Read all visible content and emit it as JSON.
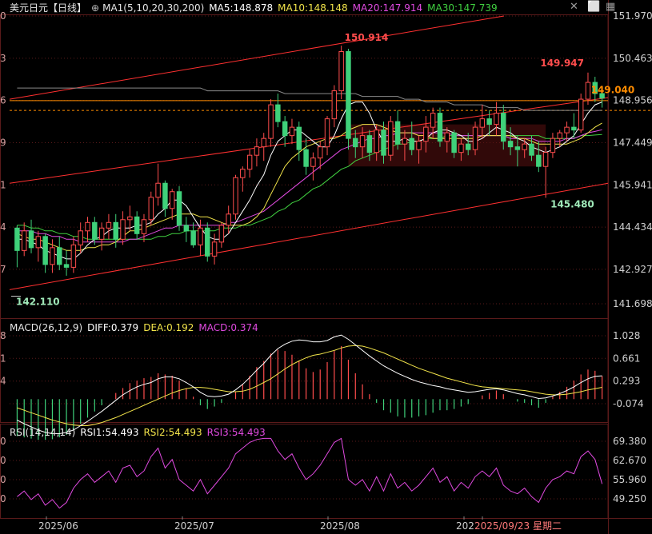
{
  "header": {
    "symbol": "美元日元",
    "period": "【日线】",
    "ma_title": "MA1(5,10,20,30,200)",
    "ma5": "MA5:148.878",
    "ma10": "MA10:148.148",
    "ma20": "MA20:147.914",
    "ma30": "MA30:147.739"
  },
  "macd_header": {
    "title": "MACD(26,12,9)",
    "diff": "DIFF:0.379",
    "dea": "DEA:0.192",
    "macd": "MACD:0.374"
  },
  "rsi_header": {
    "title": "RSI(14,14,14)",
    "rsi1": "RSI1:54.493",
    "rsi2": "RSI2:54.493",
    "rsi3": "RSI3:54.493"
  },
  "toolbar": {
    "close": "✕",
    "maximize": "⬜",
    "settings": "▦"
  },
  "colors": {
    "up": "#ff4d4d",
    "down": "#3fd17a",
    "ma5": "#ffffff",
    "ma10": "#f2e44a",
    "ma20": "#e04ae0",
    "ma30": "#40d040",
    "ma200": "#8a8a8a",
    "trend": "#ff3030",
    "hline": "#ff8c00",
    "grid": "#5a1a1a"
  },
  "chart_data": {
    "type": "candlestick",
    "x_labels": [
      "2025/06",
      "2025/07",
      "2025/08",
      "202",
      "2025/09/23 星期二"
    ],
    "price_axis": [
      "151.970",
      "150.463",
      "148.956",
      "147.449",
      "145.941",
      "144.434",
      "142.927",
      "141.698"
    ],
    "price_axis_left": [
      "0",
      "3",
      "6",
      "9",
      "1",
      "4",
      "7"
    ],
    "annotations": {
      "high": "150.914",
      "low": "142.110",
      "recent_high": "149.947",
      "recent_low": "145.480",
      "last_price": "149.040"
    },
    "ohlc": [
      [
        144.4,
        144.5,
        143.0,
        143.6
      ],
      [
        143.6,
        144.6,
        143.4,
        144.3
      ],
      [
        144.3,
        144.7,
        143.5,
        143.7
      ],
      [
        143.7,
        144.3,
        143.2,
        144.1
      ],
      [
        144.1,
        144.2,
        142.8,
        143.1
      ],
      [
        143.1,
        144.0,
        142.8,
        143.7
      ],
      [
        143.7,
        144.1,
        142.9,
        143.1
      ],
      [
        143.1,
        143.6,
        142.7,
        143.0
      ],
      [
        143.0,
        144.1,
        142.8,
        143.8
      ],
      [
        143.8,
        144.6,
        143.5,
        144.3
      ],
      [
        144.3,
        144.8,
        143.9,
        144.6
      ],
      [
        144.6,
        144.8,
        143.8,
        144.0
      ],
      [
        144.0,
        144.6,
        143.6,
        144.4
      ],
      [
        144.4,
        144.9,
        144.0,
        144.6
      ],
      [
        144.6,
        144.9,
        143.7,
        144.0
      ],
      [
        144.0,
        145.0,
        143.8,
        144.7
      ],
      [
        144.7,
        145.2,
        144.3,
        144.8
      ],
      [
        144.8,
        145.0,
        144.0,
        144.2
      ],
      [
        144.2,
        144.9,
        143.9,
        144.7
      ],
      [
        144.7,
        145.7,
        144.5,
        145.5
      ],
      [
        145.5,
        146.7,
        145.2,
        146.0
      ],
      [
        146.0,
        146.1,
        144.8,
        145.1
      ],
      [
        145.1,
        145.8,
        144.7,
        145.7
      ],
      [
        145.7,
        145.9,
        144.3,
        144.5
      ],
      [
        144.5,
        144.8,
        143.9,
        144.3
      ],
      [
        144.3,
        144.6,
        143.7,
        143.8
      ],
      [
        143.8,
        144.7,
        143.4,
        144.4
      ],
      [
        144.4,
        144.6,
        143.2,
        143.4
      ],
      [
        143.4,
        144.2,
        143.1,
        143.9
      ],
      [
        143.9,
        144.6,
        143.7,
        144.5
      ],
      [
        144.5,
        145.2,
        144.2,
        144.9
      ],
      [
        144.9,
        146.3,
        144.7,
        146.2
      ],
      [
        146.2,
        146.6,
        145.7,
        146.5
      ],
      [
        146.5,
        147.2,
        146.2,
        147.0
      ],
      [
        147.0,
        147.6,
        146.6,
        147.3
      ],
      [
        147.3,
        147.8,
        146.8,
        147.6
      ],
      [
        147.6,
        149.0,
        147.3,
        148.8
      ],
      [
        148.8,
        149.2,
        148.0,
        148.2
      ],
      [
        148.2,
        148.4,
        147.3,
        147.7
      ],
      [
        147.7,
        148.3,
        147.4,
        148.0
      ],
      [
        148.0,
        148.2,
        146.8,
        147.2
      ],
      [
        147.2,
        147.6,
        146.3,
        146.6
      ],
      [
        146.6,
        147.1,
        146.1,
        146.9
      ],
      [
        146.9,
        147.5,
        146.5,
        147.3
      ],
      [
        147.3,
        148.4,
        147.0,
        148.3
      ],
      [
        148.3,
        149.5,
        148.0,
        149.3
      ],
      [
        149.3,
        150.91,
        149.0,
        150.7
      ],
      [
        150.7,
        150.8,
        147.2,
        147.6
      ],
      [
        147.6,
        147.9,
        146.9,
        147.3
      ],
      [
        147.3,
        148.0,
        146.9,
        147.7
      ],
      [
        147.7,
        147.9,
        146.8,
        147.1
      ],
      [
        147.1,
        148.1,
        146.8,
        147.9
      ],
      [
        147.9,
        148.2,
        146.7,
        147.0
      ],
      [
        147.0,
        148.4,
        146.8,
        148.2
      ],
      [
        148.2,
        148.6,
        147.2,
        147.4
      ],
      [
        147.4,
        147.9,
        146.8,
        147.6
      ],
      [
        147.6,
        148.2,
        147.0,
        147.2
      ],
      [
        147.2,
        147.7,
        146.7,
        147.5
      ],
      [
        147.5,
        148.4,
        147.1,
        148.0
      ],
      [
        148.0,
        148.7,
        147.6,
        148.5
      ],
      [
        148.5,
        148.7,
        147.3,
        147.5
      ],
      [
        147.5,
        148.0,
        147.1,
        147.8
      ],
      [
        147.8,
        147.9,
        146.9,
        147.1
      ],
      [
        147.1,
        147.6,
        146.8,
        147.4
      ],
      [
        147.4,
        147.8,
        147.0,
        147.2
      ],
      [
        147.2,
        148.2,
        147.0,
        148.0
      ],
      [
        148.0,
        148.8,
        147.6,
        148.3
      ],
      [
        148.3,
        148.6,
        147.7,
        148.1
      ],
      [
        148.1,
        148.9,
        147.7,
        148.5
      ],
      [
        148.5,
        148.8,
        147.2,
        147.5
      ],
      [
        147.5,
        148.0,
        147.0,
        147.3
      ],
      [
        147.3,
        147.7,
        146.6,
        147.2
      ],
      [
        147.2,
        147.6,
        146.9,
        147.4
      ],
      [
        147.4,
        147.7,
        146.8,
        147.0
      ],
      [
        147.0,
        147.5,
        146.4,
        146.6
      ],
      [
        146.6,
        147.3,
        145.48,
        147.1
      ],
      [
        147.1,
        147.8,
        146.9,
        147.6
      ],
      [
        147.6,
        147.9,
        147.3,
        147.8
      ],
      [
        147.8,
        148.2,
        147.5,
        148.0
      ],
      [
        148.0,
        148.5,
        147.6,
        147.9
      ],
      [
        147.9,
        149.2,
        147.8,
        149.0
      ],
      [
        149.0,
        149.95,
        148.8,
        149.6
      ],
      [
        149.6,
        149.8,
        148.9,
        149.2
      ],
      [
        149.2,
        149.4,
        148.7,
        149.04
      ]
    ],
    "ma5": [
      144.0,
      144.0,
      143.9,
      143.8,
      143.6,
      143.5,
      143.4,
      143.3,
      143.3,
      143.5,
      143.8,
      144.0,
      144.1,
      144.3,
      144.4,
      144.4,
      144.4,
      144.5,
      144.5,
      144.6,
      144.9,
      145.1,
      145.4,
      145.4,
      145.2,
      144.8,
      144.4,
      144.1,
      144.0,
      144.0,
      144.2,
      144.6,
      145.0,
      145.4,
      145.9,
      146.3,
      147.0,
      147.5,
      147.7,
      147.9,
      147.9,
      147.7,
      147.5,
      147.3,
      147.3,
      147.7,
      148.3,
      148.8,
      148.9,
      148.9,
      148.5,
      147.9,
      147.5,
      147.5,
      147.5,
      147.6,
      147.5,
      147.5,
      147.6,
      147.8,
      147.9,
      147.9,
      147.8,
      147.7,
      147.5,
      147.5,
      147.6,
      147.8,
      148.0,
      147.9,
      147.8,
      147.6,
      147.5,
      147.3,
      147.2,
      147.1,
      147.2,
      147.3,
      147.5,
      147.7,
      148.1,
      148.5,
      148.8,
      148.9
    ],
    "ma10": [
      144.2,
      144.1,
      144.0,
      144.0,
      143.9,
      143.8,
      143.7,
      143.6,
      143.6,
      143.6,
      143.7,
      143.7,
      143.8,
      143.8,
      143.9,
      144.1,
      144.3,
      144.3,
      144.4,
      144.5,
      144.6,
      144.7,
      144.8,
      144.9,
      144.9,
      144.9,
      144.8,
      144.8,
      144.7,
      144.6,
      144.5,
      144.5,
      144.5,
      144.6,
      144.8,
      145.1,
      145.6,
      146.1,
      146.6,
      146.9,
      147.1,
      147.3,
      147.4,
      147.5,
      147.6,
      147.6,
      147.7,
      147.9,
      148.0,
      148.1,
      148.1,
      148.1,
      148.0,
      147.9,
      147.8,
      147.8,
      147.8,
      147.7,
      147.7,
      147.6,
      147.6,
      147.6,
      147.6,
      147.6,
      147.6,
      147.6,
      147.7,
      147.7,
      147.7,
      147.7,
      147.7,
      147.6,
      147.6,
      147.5,
      147.4,
      147.4,
      147.4,
      147.4,
      147.4,
      147.5,
      147.6,
      147.8,
      148.0,
      148.15
    ],
    "ma20": [
      144.3,
      144.3,
      144.3,
      144.2,
      144.2,
      144.1,
      144.1,
      144.0,
      144.0,
      143.9,
      143.9,
      143.9,
      143.9,
      143.9,
      143.9,
      143.9,
      144.0,
      144.0,
      144.1,
      144.2,
      144.3,
      144.4,
      144.4,
      144.5,
      144.5,
      144.5,
      144.5,
      144.5,
      144.5,
      144.5,
      144.6,
      144.6,
      144.7,
      144.8,
      144.9,
      145.0,
      145.2,
      145.4,
      145.6,
      145.8,
      146.0,
      146.2,
      146.4,
      146.6,
      146.8,
      147.0,
      147.2,
      147.3,
      147.4,
      147.5,
      147.6,
      147.6,
      147.7,
      147.7,
      147.8,
      147.8,
      147.8,
      147.8,
      147.8,
      147.8,
      147.8,
      147.8,
      147.7,
      147.7,
      147.7,
      147.7,
      147.7,
      147.7,
      147.7,
      147.7,
      147.6,
      147.6,
      147.6,
      147.6,
      147.5,
      147.5,
      147.5,
      147.5,
      147.6,
      147.6,
      147.7,
      147.8,
      147.85,
      147.91
    ],
    "ma30": [
      144.5,
      144.5,
      144.4,
      144.4,
      144.3,
      144.3,
      144.2,
      144.2,
      144.1,
      144.1,
      144.0,
      144.0,
      144.0,
      144.0,
      144.0,
      144.0,
      144.0,
      144.0,
      144.0,
      144.0,
      144.1,
      144.1,
      144.2,
      144.2,
      144.3,
      144.3,
      144.3,
      144.3,
      144.3,
      144.4,
      144.4,
      144.4,
      144.5,
      144.5,
      144.6,
      144.7,
      144.8,
      145.0,
      145.1,
      145.3,
      145.4,
      145.6,
      145.8,
      145.9,
      146.1,
      146.3,
      146.5,
      146.6,
      146.8,
      146.9,
      147.0,
      147.1,
      147.2,
      147.3,
      147.4,
      147.4,
      147.5,
      147.5,
      147.6,
      147.6,
      147.6,
      147.7,
      147.7,
      147.7,
      147.7,
      147.7,
      147.7,
      147.7,
      147.7,
      147.7,
      147.7,
      147.7,
      147.7,
      147.7,
      147.7,
      147.6,
      147.6,
      147.6,
      147.6,
      147.6,
      147.7,
      147.7,
      147.72,
      147.74
    ],
    "ma200": [
      149.4,
      149.4,
      149.4,
      149.4,
      149.4,
      149.4,
      149.4,
      149.4,
      149.4,
      149.4,
      149.4,
      149.4,
      149.4,
      149.4,
      149.4,
      149.4,
      149.4,
      149.4,
      149.4,
      149.4,
      149.4,
      149.4,
      149.4,
      149.4,
      149.4,
      149.4,
      149.4,
      149.3,
      149.3,
      149.3,
      149.3,
      149.3,
      149.3,
      149.3,
      149.3,
      149.3,
      149.3,
      149.3,
      149.2,
      149.2,
      149.2,
      149.2,
      149.2,
      149.2,
      149.2,
      149.2,
      149.2,
      149.2,
      149.2,
      149.1,
      149.1,
      149.1,
      149.1,
      149.1,
      149.1,
      149.0,
      149.0,
      149.0,
      148.9,
      148.9,
      148.9,
      148.9,
      148.8,
      148.8,
      148.8,
      148.8,
      148.8,
      148.7,
      148.7,
      148.7,
      148.7,
      148.7,
      148.6,
      148.6,
      148.6,
      148.6,
      148.6,
      148.6,
      148.6,
      148.6,
      148.6,
      148.6,
      148.6,
      148.6
    ],
    "macd_axis": [
      "1.028",
      "0.661",
      "0.293",
      "-0.074"
    ],
    "macd_axis_left": [
      "8",
      "1",
      "4"
    ],
    "macd_hist": [
      -0.6,
      -0.62,
      -0.64,
      -0.66,
      -0.66,
      -0.65,
      -0.62,
      -0.58,
      -0.5,
      -0.4,
      -0.3,
      -0.2,
      -0.1,
      0.0,
      0.1,
      0.18,
      0.26,
      0.3,
      0.34,
      0.36,
      0.42,
      0.4,
      0.38,
      0.3,
      0.18,
      0.04,
      -0.1,
      -0.16,
      -0.12,
      -0.06,
      0.0,
      0.12,
      0.24,
      0.38,
      0.52,
      0.62,
      0.74,
      0.8,
      0.78,
      0.72,
      0.62,
      0.5,
      0.44,
      0.48,
      0.6,
      0.78,
      0.86,
      0.64,
      0.42,
      0.24,
      0.08,
      -0.06,
      -0.18,
      -0.22,
      -0.28,
      -0.3,
      -0.3,
      -0.28,
      -0.26,
      -0.22,
      -0.18,
      -0.18,
      -0.16,
      -0.12,
      -0.08,
      0.0,
      0.06,
      0.1,
      0.14,
      0.08,
      0.0,
      -0.04,
      -0.06,
      -0.1,
      -0.14,
      -0.06,
      0.04,
      0.12,
      0.2,
      0.3,
      0.4,
      0.48,
      0.46,
      0.374
    ],
    "macd_diff": [
      -0.34,
      -0.4,
      -0.45,
      -0.5,
      -0.54,
      -0.56,
      -0.56,
      -0.54,
      -0.5,
      -0.43,
      -0.36,
      -0.28,
      -0.2,
      -0.11,
      -0.02,
      0.07,
      0.14,
      0.2,
      0.24,
      0.27,
      0.33,
      0.36,
      0.36,
      0.33,
      0.27,
      0.2,
      0.11,
      0.05,
      0.04,
      0.05,
      0.08,
      0.15,
      0.24,
      0.35,
      0.47,
      0.58,
      0.71,
      0.82,
      0.89,
      0.94,
      0.96,
      0.95,
      0.93,
      0.93,
      0.95,
      1.01,
      1.04,
      0.97,
      0.88,
      0.79,
      0.7,
      0.62,
      0.54,
      0.48,
      0.42,
      0.37,
      0.32,
      0.28,
      0.25,
      0.22,
      0.2,
      0.17,
      0.15,
      0.13,
      0.11,
      0.12,
      0.14,
      0.16,
      0.17,
      0.15,
      0.12,
      0.09,
      0.07,
      0.04,
      0.01,
      0.02,
      0.05,
      0.09,
      0.14,
      0.2,
      0.27,
      0.33,
      0.37,
      0.379
    ],
    "macd_dea": [
      -0.14,
      -0.18,
      -0.22,
      -0.26,
      -0.3,
      -0.34,
      -0.37,
      -0.4,
      -0.42,
      -0.43,
      -0.43,
      -0.41,
      -0.38,
      -0.34,
      -0.3,
      -0.25,
      -0.2,
      -0.15,
      -0.1,
      -0.05,
      0.0,
      0.05,
      0.1,
      0.14,
      0.17,
      0.19,
      0.19,
      0.18,
      0.16,
      0.14,
      0.12,
      0.12,
      0.13,
      0.16,
      0.21,
      0.27,
      0.33,
      0.41,
      0.49,
      0.56,
      0.62,
      0.67,
      0.71,
      0.73,
      0.76,
      0.79,
      0.83,
      0.86,
      0.87,
      0.86,
      0.83,
      0.79,
      0.75,
      0.7,
      0.65,
      0.6,
      0.55,
      0.5,
      0.46,
      0.42,
      0.38,
      0.34,
      0.31,
      0.28,
      0.25,
      0.22,
      0.2,
      0.19,
      0.18,
      0.17,
      0.16,
      0.15,
      0.14,
      0.12,
      0.1,
      0.08,
      0.07,
      0.07,
      0.08,
      0.1,
      0.12,
      0.15,
      0.17,
      0.192
    ],
    "rsi_axis": [
      "69.380",
      "62.670",
      "55.960",
      "49.250"
    ],
    "rsi_axis_left": [
      "0",
      "0",
      "0",
      "0"
    ],
    "rsi": [
      50,
      52,
      49,
      51,
      47,
      49,
      46,
      48,
      53,
      56,
      58,
      55,
      57,
      59,
      55,
      60,
      61,
      57,
      59,
      64,
      67,
      60,
      63,
      56,
      54,
      52,
      56,
      51,
      54,
      57,
      60,
      65,
      67,
      69,
      70,
      71,
      72,
      66,
      63,
      65,
      60,
      56,
      58,
      61,
      65,
      69,
      71,
      56,
      54,
      56,
      52,
      57,
      52,
      58,
      53,
      55,
      52,
      54,
      57,
      60,
      55,
      57,
      52,
      55,
      53,
      57,
      59,
      57,
      60,
      54,
      52,
      51,
      53,
      50,
      48,
      53,
      56,
      57,
      59,
      58,
      64,
      66,
      63,
      54.49
    ]
  }
}
